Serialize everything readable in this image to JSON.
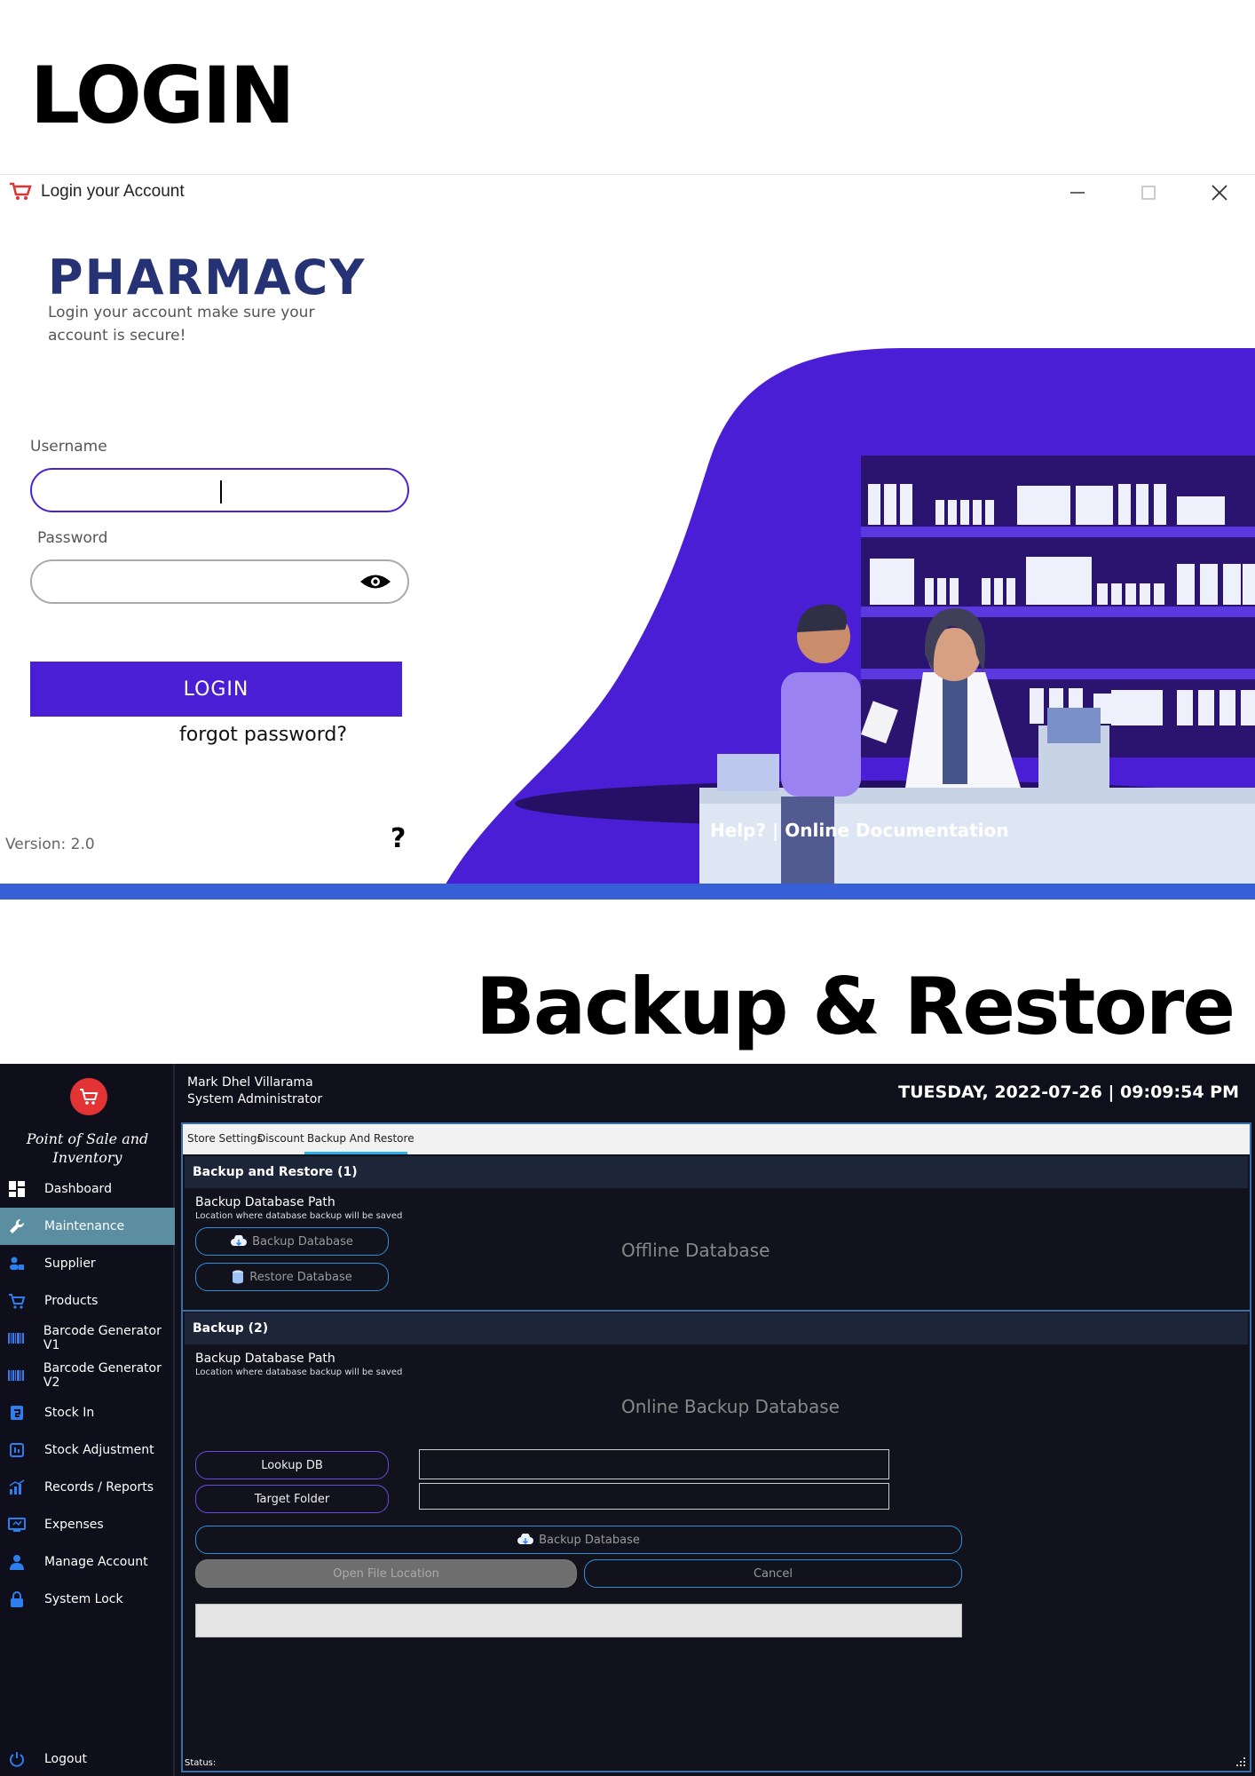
{
  "headings": {
    "login": "LOGIN",
    "backup": "Backup & Restore"
  },
  "login_window": {
    "title": "Login your Account",
    "controls": [
      "minimize",
      "maximize",
      "close"
    ],
    "brand": "PHARMACY",
    "brand_subtitle": "Login your account make sure your account is secure!",
    "username_label": "Username",
    "username_value": "",
    "password_label": "Password",
    "password_value": "",
    "login_button": "LOGIN",
    "forgot_link": "forgot password?",
    "version": "Version: 2.0",
    "help_icon": "?",
    "help_link": "Help? | Online Documentation",
    "colors": {
      "accent": "#4a1ed4",
      "brand": "#253374",
      "bottom_bar": "#3860d6"
    }
  },
  "pos_window": {
    "app_name_line1": "Point of Sale and",
    "app_name_line2": "Inventory",
    "user_name": "Mark Dhel Villarama",
    "user_role": "System Administrator",
    "clock": "TUESDAY, 2022-07-26 | 09:09:54 PM",
    "nav": [
      {
        "label": "Dashboard",
        "icon": "dashboard-icon"
      },
      {
        "label": "Maintenance",
        "icon": "wrench-icon",
        "active": true
      },
      {
        "label": "Supplier",
        "icon": "supplier-icon"
      },
      {
        "label": "Products",
        "icon": "cart-icon"
      },
      {
        "label": "Barcode Generator V1",
        "icon": "barcode-icon"
      },
      {
        "label": "Barcode Generator V2",
        "icon": "barcode-icon"
      },
      {
        "label": "Stock In",
        "icon": "stock-in-icon"
      },
      {
        "label": "Stock Adjustment",
        "icon": "stock-adjustment-icon"
      },
      {
        "label": "Records / Reports",
        "icon": "chart-icon"
      },
      {
        "label": "Expenses",
        "icon": "expenses-icon"
      },
      {
        "label": "Manage Account",
        "icon": "user-icon"
      },
      {
        "label": "System Lock",
        "icon": "lock-icon"
      }
    ],
    "logout": "Logout",
    "tabs": [
      "Store Settings",
      "Discount",
      "Backup And Restore"
    ],
    "active_tab": "Backup And Restore",
    "section1": {
      "title": "Backup and Restore (1)",
      "path_title": "Backup Database Path",
      "path_sub": "Location where database backup will be saved",
      "backup_button": "Backup Database",
      "restore_button": "Restore Database",
      "label": "Offline Database"
    },
    "section2": {
      "title": "Backup (2)",
      "path_title": "Backup Database Path",
      "path_sub": "Location where database backup will be saved",
      "label": "Online Backup Database",
      "lookup_button": "Lookup DB",
      "lookup_value": "",
      "target_button": "Target Folder",
      "target_value": "",
      "backup_button": "Backup Database",
      "open_button": "Open File Location",
      "cancel_button": "Cancel",
      "progress": 0
    },
    "status_label": "Status:",
    "colors": {
      "background": "#10101c",
      "active_nav": "#5b8ea1",
      "section_bar": "#1d2538",
      "logo": "#e23434"
    }
  }
}
